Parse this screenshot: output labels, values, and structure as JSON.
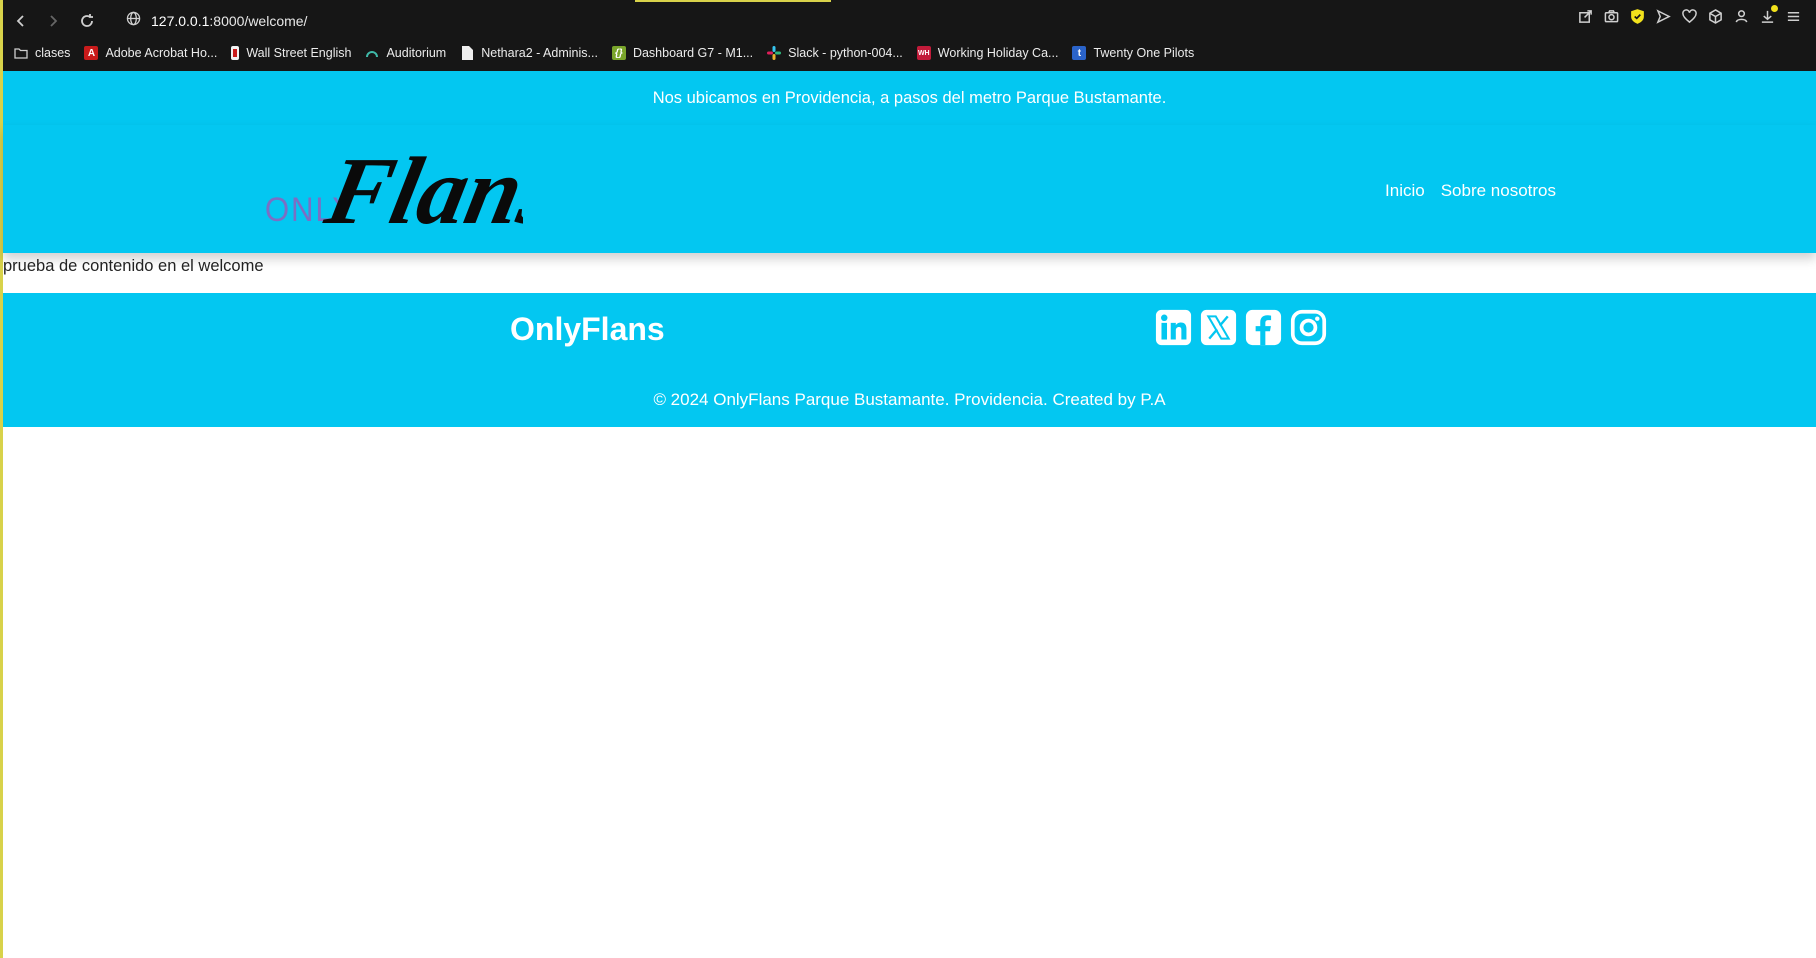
{
  "browser": {
    "url_host": "127.0.0.1",
    "url_path": ":8000/welcome/",
    "bookmarks": [
      {
        "label": "clases",
        "icon": "folder-icon"
      },
      {
        "label": "Adobe Acrobat Ho...",
        "icon": "acrobat-icon"
      },
      {
        "label": "Wall Street English",
        "icon": "wse-icon"
      },
      {
        "label": "Auditorium",
        "icon": "auditorium-icon"
      },
      {
        "label": "Nethara2 - Adminis...",
        "icon": "document-icon"
      },
      {
        "label": "Dashboard G7 - M1...",
        "icon": "dashboard-icon"
      },
      {
        "label": "Slack - python-004...",
        "icon": "slack-icon"
      },
      {
        "label": "Working Holiday Ca...",
        "icon": "whv-icon"
      },
      {
        "label": "Twenty One Pilots",
        "icon": "tumblr-icon"
      }
    ]
  },
  "site": {
    "announcement": "Nos ubicamos en Providencia, a pasos del metro Parque Bustamante.",
    "logo": {
      "small_text": "ONLY",
      "script_text": "Flans"
    },
    "nav": [
      "Inicio",
      "Sobre nosotros"
    ],
    "content_text": "prueba de contenido en el welcome",
    "footer": {
      "brand": "OnlyFlans",
      "copyright": "© 2024 OnlyFlans Parque Bustamante. Providencia. Created by P.A",
      "socials": [
        "linkedin-icon",
        "x-icon",
        "facebook-icon",
        "instagram-icon"
      ]
    }
  },
  "colors": {
    "brand_cyan": "#03c7f1",
    "chrome_bg": "#161616",
    "logo_purple": "#7a6fc4"
  }
}
